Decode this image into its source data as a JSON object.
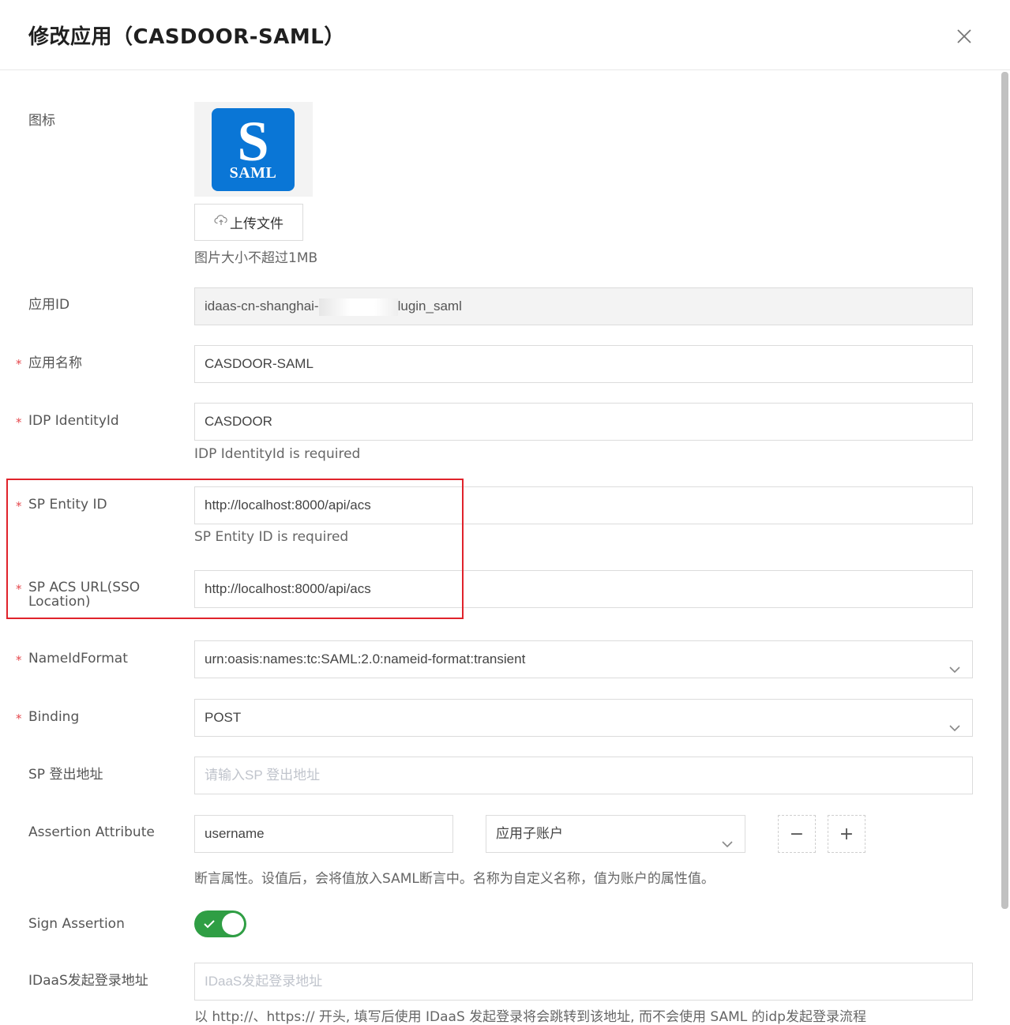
{
  "header": {
    "title": "修改应用（CASDOOR-SAML）"
  },
  "icon_section": {
    "label": "图标",
    "logo_letter": "S",
    "logo_text": "SAML",
    "upload_label": "上传文件",
    "hint": "图片大小不超过1MB"
  },
  "fields": {
    "app_id": {
      "label": "应用ID",
      "value": "idaas-cn-shanghai-",
      "value_suffix": "lugin_saml"
    },
    "app_name": {
      "label": "应用名称",
      "value": "CASDOOR-SAML"
    },
    "idp_identity": {
      "label": "IDP IdentityId",
      "value": "CASDOOR",
      "help": "IDP IdentityId is required"
    },
    "sp_entity": {
      "label": "SP Entity ID",
      "value": "http://localhost:8000/api/acs",
      "help": "SP Entity ID is required"
    },
    "sp_acs": {
      "label_line1": "SP ACS URL(SSO",
      "label_line2": "Location)",
      "value": "http://localhost:8000/api/acs"
    },
    "name_id_format": {
      "label": "NameIdFormat",
      "value": "urn:oasis:names:tc:SAML:2.0:nameid-format:transient"
    },
    "binding": {
      "label": "Binding",
      "value": "POST"
    },
    "sp_logout": {
      "label": "SP 登出地址",
      "placeholder": "请输入SP 登出地址"
    },
    "assertion_attribute": {
      "label": "Assertion Attribute",
      "name_value": "username",
      "attr_value": "应用子账户",
      "minus": "−",
      "plus": "+",
      "help": "断言属性。设值后，会将值放入SAML断言中。名称为自定义名称，值为账户的属性值。"
    },
    "sign_assertion": {
      "label": "Sign Assertion",
      "enabled": true
    },
    "idaas_login": {
      "label": "IDaaS发起登录地址",
      "placeholder": "IDaaS发起登录地址",
      "help": "以 http://、https:// 开头, 填写后使用 IDaaS 发起登录将会跳转到该地址, 而不会使用 SAML 的idp发起登录流程"
    }
  },
  "required_mark": "*",
  "colors": {
    "accent_green": "#2f9e44",
    "required_red": "#e5484d",
    "highlight_box": "#e0232b",
    "logo_blue": "#0a76d6"
  }
}
